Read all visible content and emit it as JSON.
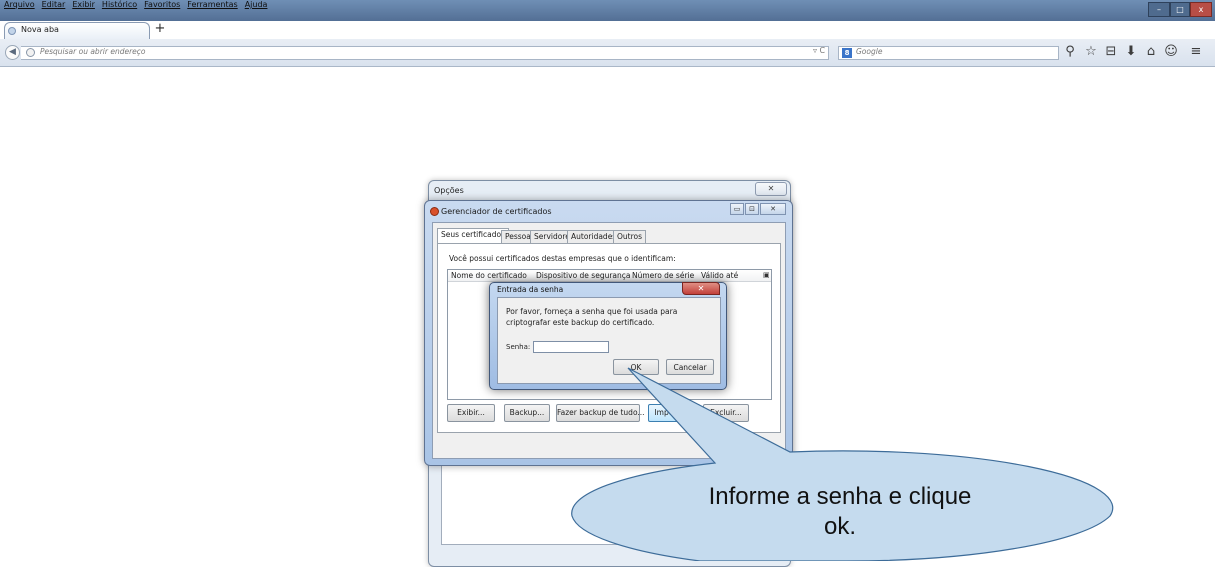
{
  "browser": {
    "menu": [
      "Arquivo",
      "Editar",
      "Exibir",
      "Histórico",
      "Favoritos",
      "Ferramentas",
      "Ajuda"
    ],
    "window_controls": {
      "minimize": "–",
      "maximize": "□",
      "close": "x"
    },
    "tab_title": "Nova aba",
    "new_tab": "+",
    "back": "◀",
    "url_placeholder": "Pesquisar ou abrir endereço",
    "url_arrows": "▿ C",
    "search_engine_letter": "8",
    "search_placeholder": "Google",
    "search_go": "⚲",
    "toolbar_icons": [
      "⚲",
      "☆",
      "⊟",
      "⬇",
      "⌂",
      "☺",
      "≡"
    ]
  },
  "options_dialog": {
    "title": "Opções",
    "close": "✕"
  },
  "cert_manager": {
    "title": "Gerenciador de certificados",
    "title_buttons": {
      "minimize": "▭",
      "maximize": "⊡",
      "close": "✕"
    },
    "tabs": [
      "Seus certificados",
      "Pessoas",
      "Servidores",
      "Autoridades",
      "Outros"
    ],
    "description": "Você possui certificados destas empresas que o identificam:",
    "columns": [
      "Nome do certificado",
      "Dispositivo de segurança",
      "Número de série",
      "Válido até"
    ],
    "buttons": {
      "view": "Exibir...",
      "backup": "Backup...",
      "backup_all": "Fazer backup de tudo...",
      "import": "Importar...",
      "delete": "Excluir..."
    }
  },
  "password_prompt": {
    "title": "Entrada da senha",
    "close": "✕",
    "message": "Por favor, forneça a senha que foi usada para criptografar este backup do certificado.",
    "label": "Senha:",
    "value": "",
    "ok": "OK",
    "cancel": "Cancelar"
  },
  "callout": {
    "line1": "Informe a senha e clique",
    "line2": "ok."
  }
}
